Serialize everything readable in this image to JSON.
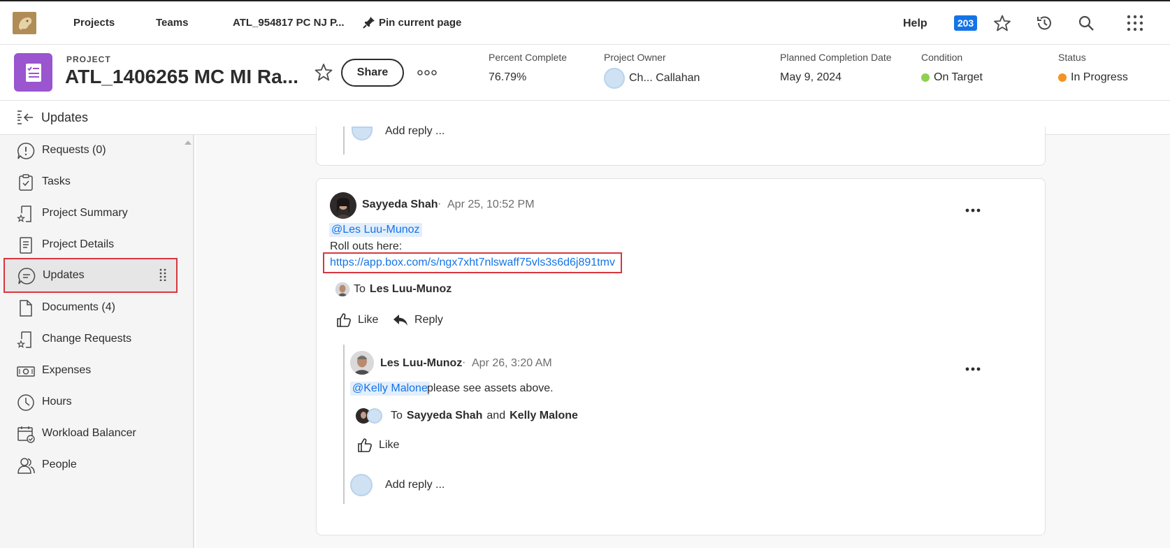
{
  "topnav": {
    "projects_label": "Projects",
    "teams_label": "Teams",
    "recent_label": "ATL_954817 PC NJ P...",
    "pin_label": "Pin current page",
    "help_label": "Help",
    "notification_count": "203"
  },
  "project": {
    "kicker": "PROJECT",
    "title": "ATL_1406265 MC MI Ra...",
    "share_label": "Share",
    "percent_complete_label": "Percent Complete",
    "percent_complete_value": "76.79%",
    "owner_label": "Project Owner",
    "owner_value": "Ch... Callahan",
    "planned_label": "Planned Completion Date",
    "planned_value": "May 9, 2024",
    "condition_label": "Condition",
    "condition_value": "On Target",
    "condition_color": "#8fd14f",
    "status_label": "Status",
    "status_value": "In Progress",
    "status_color": "#f29423"
  },
  "section": {
    "title": "Updates"
  },
  "sidebar": {
    "items": [
      {
        "label": "Requests (0)"
      },
      {
        "label": "Tasks"
      },
      {
        "label": "Project Summary"
      },
      {
        "label": "Project Details"
      },
      {
        "label": "Updates"
      },
      {
        "label": "Documents (4)"
      },
      {
        "label": "Change Requests"
      },
      {
        "label": "Expenses"
      },
      {
        "label": "Hours"
      },
      {
        "label": "Workload Balancer"
      },
      {
        "label": "People"
      }
    ]
  },
  "feed": {
    "prev_add_reply": "Add reply ...",
    "post": {
      "author": "Sayyeda Shah",
      "time": "Apr 25, 10:52 PM",
      "mention": "@Les Luu-Munoz",
      "line1": "Roll outs here:",
      "link": "https://app.box.com/s/ngx7xht7nlswaff75vls3s6d6j891tmv",
      "to_prefix": "To",
      "to_name": "Les Luu-Munoz",
      "like_label": "Like",
      "reply_label": "Reply"
    },
    "reply": {
      "author": "Les Luu-Munoz",
      "time": "Apr 26, 3:20 AM",
      "mention": "@Kelly Malone",
      "text": "please see assets above.",
      "to_prefix": "To",
      "to_name1": "Sayyeda Shah",
      "to_and": "and",
      "to_name2": "Kelly Malone",
      "like_label": "Like",
      "add_reply": "Add reply ..."
    }
  }
}
